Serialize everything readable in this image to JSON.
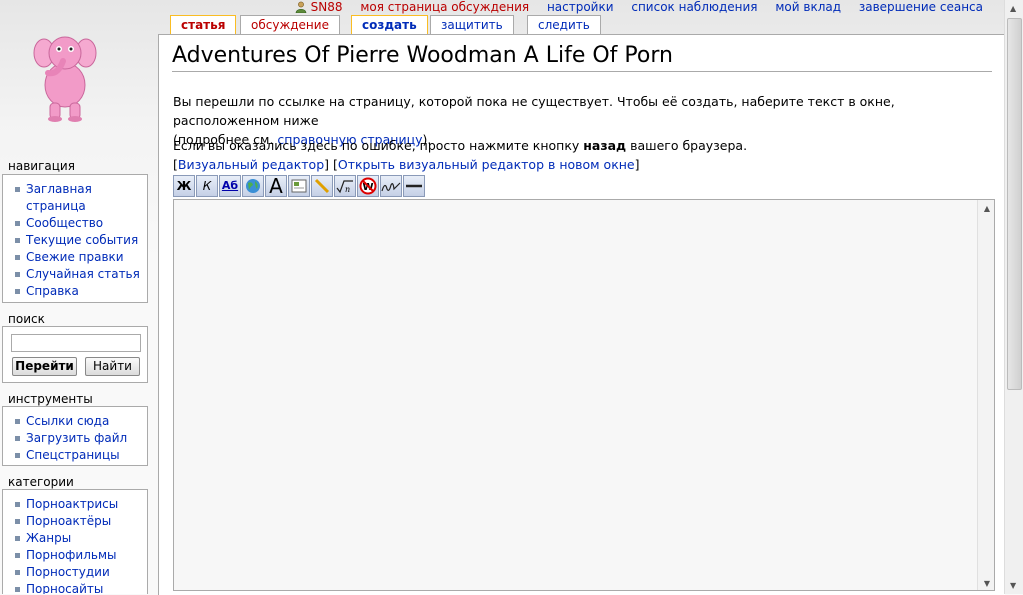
{
  "personal": {
    "user": "SN88",
    "talk": "моя страница обсуждения",
    "prefs": "настройки",
    "watchlist": "список наблюдения",
    "contribs": "мой вклад",
    "logout": "завершение сеанса"
  },
  "tabs": {
    "article": "статья",
    "discussion": "обсуждение",
    "create": "создать",
    "protect": "защитить",
    "watch": "следить"
  },
  "page": {
    "title": "Adventures Of Pierre Woodman A Life Of Porn",
    "intro_line1": "Вы перешли по ссылке на страницу, которой пока не существует. Чтобы её создать, наберите текст в окне, расположенном ниже",
    "intro_open": "(подробнее см. ",
    "intro_link": "справочную страницу",
    "intro_close": ").",
    "back_before": "Если вы оказались здесь по ошибке, просто нажмите кнопку ",
    "back_bold": "назад",
    "back_after": " вашего браузера.",
    "visual_editor": "Визуальный редактор",
    "visual_editor_new": "Открыть визуальный редактор в новом окне"
  },
  "toolbar": {
    "bold": "Ж",
    "italic": "К",
    "link": "Аб",
    "headline": "A"
  },
  "sidebar": {
    "nav_title": "навигация",
    "nav_items": [
      "Заглавная страница",
      "Сообщество",
      "Текущие события",
      "Свежие правки",
      "Случайная статья",
      "Справка"
    ],
    "search_title": "поиск",
    "go": "Перейти",
    "search": "Найти",
    "tools_title": "инструменты",
    "tools_items": [
      "Ссылки сюда",
      "Загрузить файл",
      "Спецстраницы"
    ],
    "cat_title": "категории",
    "cat_items": [
      "Порноактрисы",
      "Порноактёры",
      "Жанры",
      "Порнофильмы",
      "Порностудии",
      "Порносайты"
    ]
  },
  "colors": {
    "link": "#002bb8",
    "redlink": "#ba0000",
    "tab_selected": "#fabd23"
  },
  "icons": [
    "user-icon",
    "logo-pink-elephant",
    "globe-link-icon",
    "image-icon",
    "media-icon",
    "math-icon",
    "nowiki-icon",
    "signature-icon",
    "hr-icon"
  ]
}
